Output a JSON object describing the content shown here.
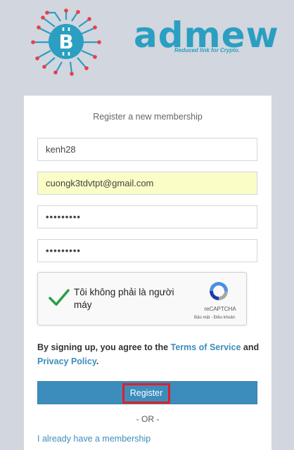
{
  "brand": {
    "name": "admew",
    "tagline": "Reduced link for Crypto."
  },
  "form": {
    "title": "Register a new membership",
    "username_value": "kenh28",
    "email_value": "cuongk3tdvtpt@gmail.com",
    "password_value": "•••••••••",
    "password_confirm_value": "•••••••••"
  },
  "captcha": {
    "label": "Tôi không phải là người máy",
    "brand": "reCAPTCHA",
    "links": "Bảo mật - Điều khoản",
    "checked": true
  },
  "terms": {
    "prefix": "By signing up, you agree to the ",
    "tos_link": "Terms of Service",
    "and": " and ",
    "privacy_link": "Privacy Policy",
    "suffix": "."
  },
  "actions": {
    "register_label": "Register",
    "or_label": "- OR -",
    "login_link": "I already have a membership"
  },
  "colors": {
    "page_bg": "#d2d6de",
    "accent": "#3c8dbc",
    "logo": "#2a9fc2",
    "circuit_dots": "#e83e4b",
    "highlight": "#e41e26"
  }
}
